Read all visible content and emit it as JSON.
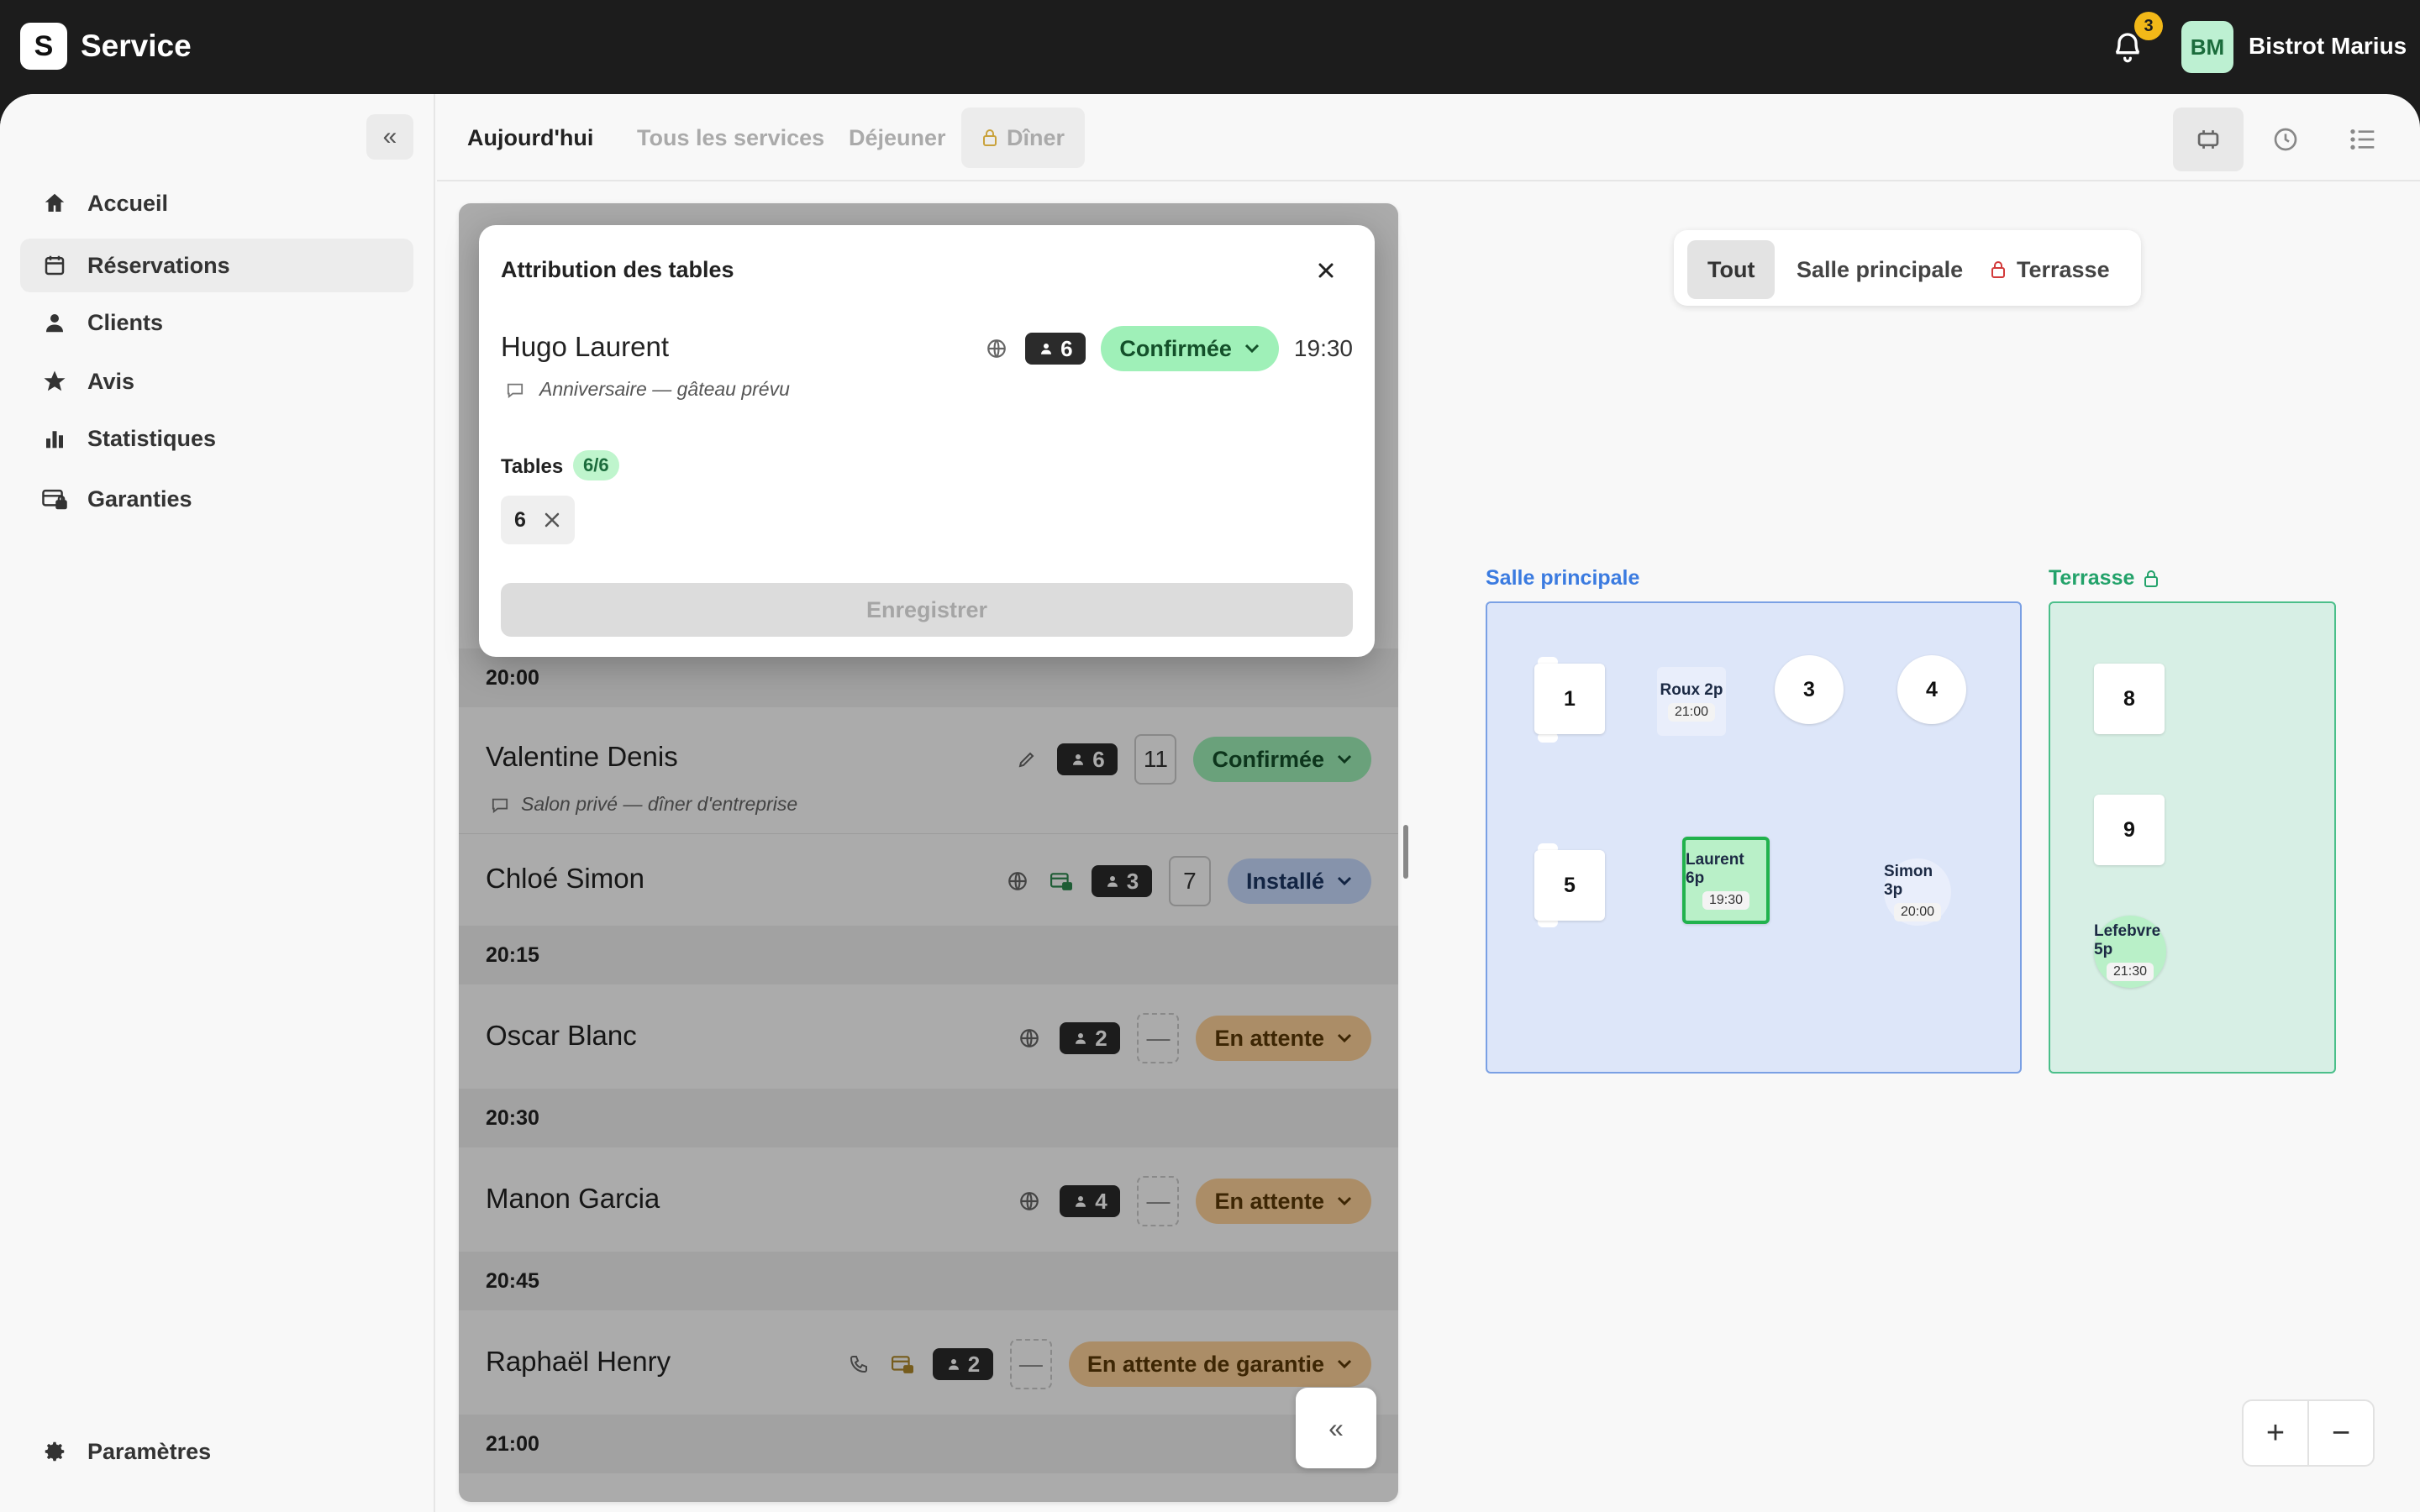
{
  "app": {
    "logo_letter": "S",
    "title": "Service",
    "notifications": "3",
    "avatar_initials": "BM",
    "restaurant_name": "Bistrot Marius"
  },
  "sidebar": {
    "items": [
      {
        "label": "Accueil",
        "icon": "home-icon"
      },
      {
        "label": "Réservations",
        "icon": "calendar-icon",
        "active": true
      },
      {
        "label": "Clients",
        "icon": "person-icon"
      },
      {
        "label": "Avis",
        "icon": "star-icon"
      },
      {
        "label": "Statistiques",
        "icon": "bar-chart-icon"
      },
      {
        "label": "Garanties",
        "icon": "card-lock-icon"
      }
    ],
    "settings_label": "Paramètres",
    "collapse_glyph": "«"
  },
  "tabs": [
    "Aujourd'hui",
    "Tous les services",
    "Déjeuner",
    "Dîner"
  ],
  "zone_filter": [
    "Tout",
    "Salle principale",
    "Terrasse"
  ],
  "zones": {
    "main": "Salle principale",
    "terrace": "Terrasse"
  },
  "modal": {
    "title": "Attribution des tables",
    "guest_name": "Hugo Laurent",
    "party": "6",
    "status": "Confirmée",
    "time": "19:30",
    "note": "Anniversaire — gâteau prévu",
    "tables_label": "Tables",
    "tables_count": "6/6",
    "table_chip": "6",
    "save_label": "Enregistrer"
  },
  "list": {
    "t2000": "20:00",
    "t2015": "20:15",
    "t2030": "20:30",
    "t2045": "20:45",
    "t2100": "21:00",
    "r1": {
      "name": "Valentine Denis",
      "party": "6",
      "table": "11",
      "status": "Confirmée",
      "note": "Salon privé — dîner d'entreprise"
    },
    "r2": {
      "name": "Chloé Simon",
      "party": "3",
      "table": "7",
      "status": "Installé"
    },
    "r3": {
      "name": "Oscar Blanc",
      "party": "2",
      "table": "—",
      "status": "En attente"
    },
    "r4": {
      "name": "Manon Garcia",
      "party": "4",
      "table": "—",
      "status": "En attente"
    },
    "r5": {
      "name": "Raphaël Henry",
      "party": "2",
      "table": "—",
      "status": "En attente de garantie"
    },
    "expand_glyph": "«"
  },
  "floor": {
    "t1": "1",
    "t3": "3",
    "t4": "4",
    "t5": "5",
    "t8": "8",
    "t9": "9",
    "roux": {
      "guest": "Roux 2p",
      "time": "21:00"
    },
    "laurent": {
      "guest": "Laurent 6p",
      "time": "19:30"
    },
    "simon": {
      "guest": "Simon 3p",
      "time": "20:00"
    },
    "lefebvre": {
      "guest": "Lefebvre 5p",
      "time": "21:30"
    }
  },
  "zoom": {
    "in": "+",
    "out": "−"
  },
  "colors": {
    "confirmed": "#9ff0b8",
    "seated": "#c8dcff",
    "waiting": "#ffd39a",
    "main_zone": "#dde6f9",
    "terrace_zone": "#d7efe5",
    "selected_table": "#21b24d"
  }
}
